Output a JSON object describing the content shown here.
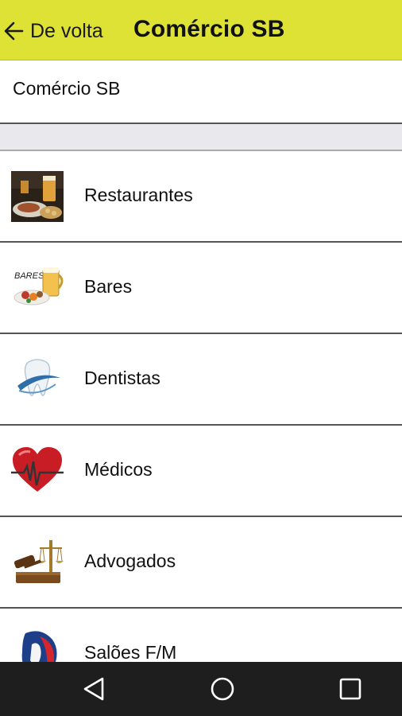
{
  "topbar": {
    "back_label": "De volta",
    "title": "Comércio SB"
  },
  "page_header": {
    "title": "Comércio SB"
  },
  "categories": [
    {
      "label": "Restaurantes",
      "icon": "restaurant-food-icon"
    },
    {
      "label": "Bares",
      "icon": "bar-beer-icon"
    },
    {
      "label": "Dentistas",
      "icon": "tooth-icon"
    },
    {
      "label": "Médicos",
      "icon": "heart-pulse-icon"
    },
    {
      "label": "Advogados",
      "icon": "scales-gavel-icon"
    },
    {
      "label": "Salões F/M",
      "icon": "salon-icon"
    }
  ],
  "colors": {
    "accent": "#dde235",
    "navbar": "#1e1e1e"
  }
}
